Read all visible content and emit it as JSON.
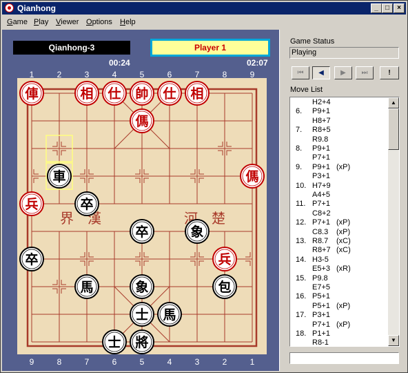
{
  "window": {
    "title": "Qianhong"
  },
  "menu": [
    {
      "label": "Game",
      "key": "G"
    },
    {
      "label": "Play",
      "key": "P"
    },
    {
      "label": "Viewer",
      "key": "V"
    },
    {
      "label": "Options",
      "key": "O"
    },
    {
      "label": "Help",
      "key": "H"
    }
  ],
  "board_panel": {
    "engine_name": "Qianhong-3",
    "turn": "Player 1",
    "clock_left": "00:24",
    "clock_right": "02:07",
    "top_files": [
      "1",
      "2",
      "3",
      "4",
      "5",
      "6",
      "7",
      "8",
      "9"
    ],
    "bottom_files": [
      "9",
      "8",
      "7",
      "6",
      "5",
      "4",
      "3",
      "2",
      "1"
    ],
    "river_left": "界　漢",
    "river_right": "河　楚",
    "colors": {
      "board": "#eedcb8",
      "grid": "#a83a2a",
      "red": "#c00000",
      "black": "#000000",
      "selection": "#ffff80"
    },
    "pieces": [
      {
        "char": "俥",
        "side": "red",
        "file": 0,
        "rank": 0
      },
      {
        "char": "相",
        "side": "red",
        "file": 2,
        "rank": 0
      },
      {
        "char": "仕",
        "side": "red",
        "file": 3,
        "rank": 0
      },
      {
        "char": "帥",
        "side": "red",
        "file": 4,
        "rank": 0
      },
      {
        "char": "仕",
        "side": "red",
        "file": 5,
        "rank": 0
      },
      {
        "char": "相",
        "side": "red",
        "file": 6,
        "rank": 0
      },
      {
        "char": "傌",
        "side": "red",
        "file": 4,
        "rank": 1
      },
      {
        "char": "車",
        "side": "black",
        "file": 1,
        "rank": 3
      },
      {
        "char": "傌",
        "side": "red",
        "file": 8,
        "rank": 3
      },
      {
        "char": "兵",
        "side": "red",
        "file": 0,
        "rank": 4
      },
      {
        "char": "卒",
        "side": "black",
        "file": 2,
        "rank": 4
      },
      {
        "char": "卒",
        "side": "black",
        "file": 4,
        "rank": 5
      },
      {
        "char": "象",
        "side": "black",
        "file": 6,
        "rank": 5
      },
      {
        "char": "卒",
        "side": "black",
        "file": 0,
        "rank": 6
      },
      {
        "char": "兵",
        "side": "red",
        "file": 7,
        "rank": 6
      },
      {
        "char": "馬",
        "side": "black",
        "file": 2,
        "rank": 7
      },
      {
        "char": "象",
        "side": "black",
        "file": 4,
        "rank": 7
      },
      {
        "char": "包",
        "side": "black",
        "file": 7,
        "rank": 7
      },
      {
        "char": "士",
        "side": "black",
        "file": 4,
        "rank": 8
      },
      {
        "char": "馬",
        "side": "black",
        "file": 5,
        "rank": 8
      },
      {
        "char": "士",
        "side": "black",
        "file": 3,
        "rank": 9
      },
      {
        "char": "將",
        "side": "black",
        "file": 4,
        "rank": 9
      }
    ],
    "selection": [
      {
        "file": 1,
        "rank": 2
      },
      {
        "file": 1,
        "rank": 3
      }
    ]
  },
  "right_panel": {
    "game_status_label": "Game Status",
    "game_status_value": "Playing",
    "nav_buttons": [
      {
        "name": "first-move",
        "glyph": "⏮"
      },
      {
        "name": "prev-move",
        "glyph": "◀"
      },
      {
        "name": "next-move",
        "glyph": "▶"
      },
      {
        "name": "last-move",
        "glyph": "⏭"
      },
      {
        "name": "hint",
        "glyph": "!"
      }
    ],
    "move_list_label": "Move List",
    "moves": [
      {
        "num": "",
        "move": "H2+4",
        "tag": ""
      },
      {
        "num": "6.",
        "move": "P9+1",
        "tag": ""
      },
      {
        "num": "",
        "move": "H8+7",
        "tag": ""
      },
      {
        "num": "7.",
        "move": "R8+5",
        "tag": ""
      },
      {
        "num": "",
        "move": "R9.8",
        "tag": ""
      },
      {
        "num": "8.",
        "move": "P9+1",
        "tag": ""
      },
      {
        "num": "",
        "move": "P7+1",
        "tag": ""
      },
      {
        "num": "9.",
        "move": "P9+1",
        "tag": "(xP)"
      },
      {
        "num": "",
        "move": "P3+1",
        "tag": ""
      },
      {
        "num": "10.",
        "move": "H7+9",
        "tag": ""
      },
      {
        "num": "",
        "move": "A4+5",
        "tag": ""
      },
      {
        "num": "11.",
        "move": "P7+1",
        "tag": ""
      },
      {
        "num": "",
        "move": "C8+2",
        "tag": ""
      },
      {
        "num": "12.",
        "move": "P7+1",
        "tag": "(xP)"
      },
      {
        "num": "",
        "move": "C8.3",
        "tag": "(xP)"
      },
      {
        "num": "13.",
        "move": "R8.7",
        "tag": "(xC)"
      },
      {
        "num": "",
        "move": "R8+7",
        "tag": "(xC)"
      },
      {
        "num": "14.",
        "move": "H3-5",
        "tag": ""
      },
      {
        "num": "",
        "move": "E5+3",
        "tag": "(xR)"
      },
      {
        "num": "15.",
        "move": "P9.8",
        "tag": ""
      },
      {
        "num": "",
        "move": "E7+5",
        "tag": ""
      },
      {
        "num": "16.",
        "move": "P5+1",
        "tag": ""
      },
      {
        "num": "",
        "move": "P5+1",
        "tag": "(xP)"
      },
      {
        "num": "17.",
        "move": "P3+1",
        "tag": ""
      },
      {
        "num": "",
        "move": "P7+1",
        "tag": "(xP)"
      },
      {
        "num": "18.",
        "move": "P1+1",
        "tag": ""
      },
      {
        "num": "",
        "move": "R8-1",
        "tag": ""
      }
    ]
  }
}
